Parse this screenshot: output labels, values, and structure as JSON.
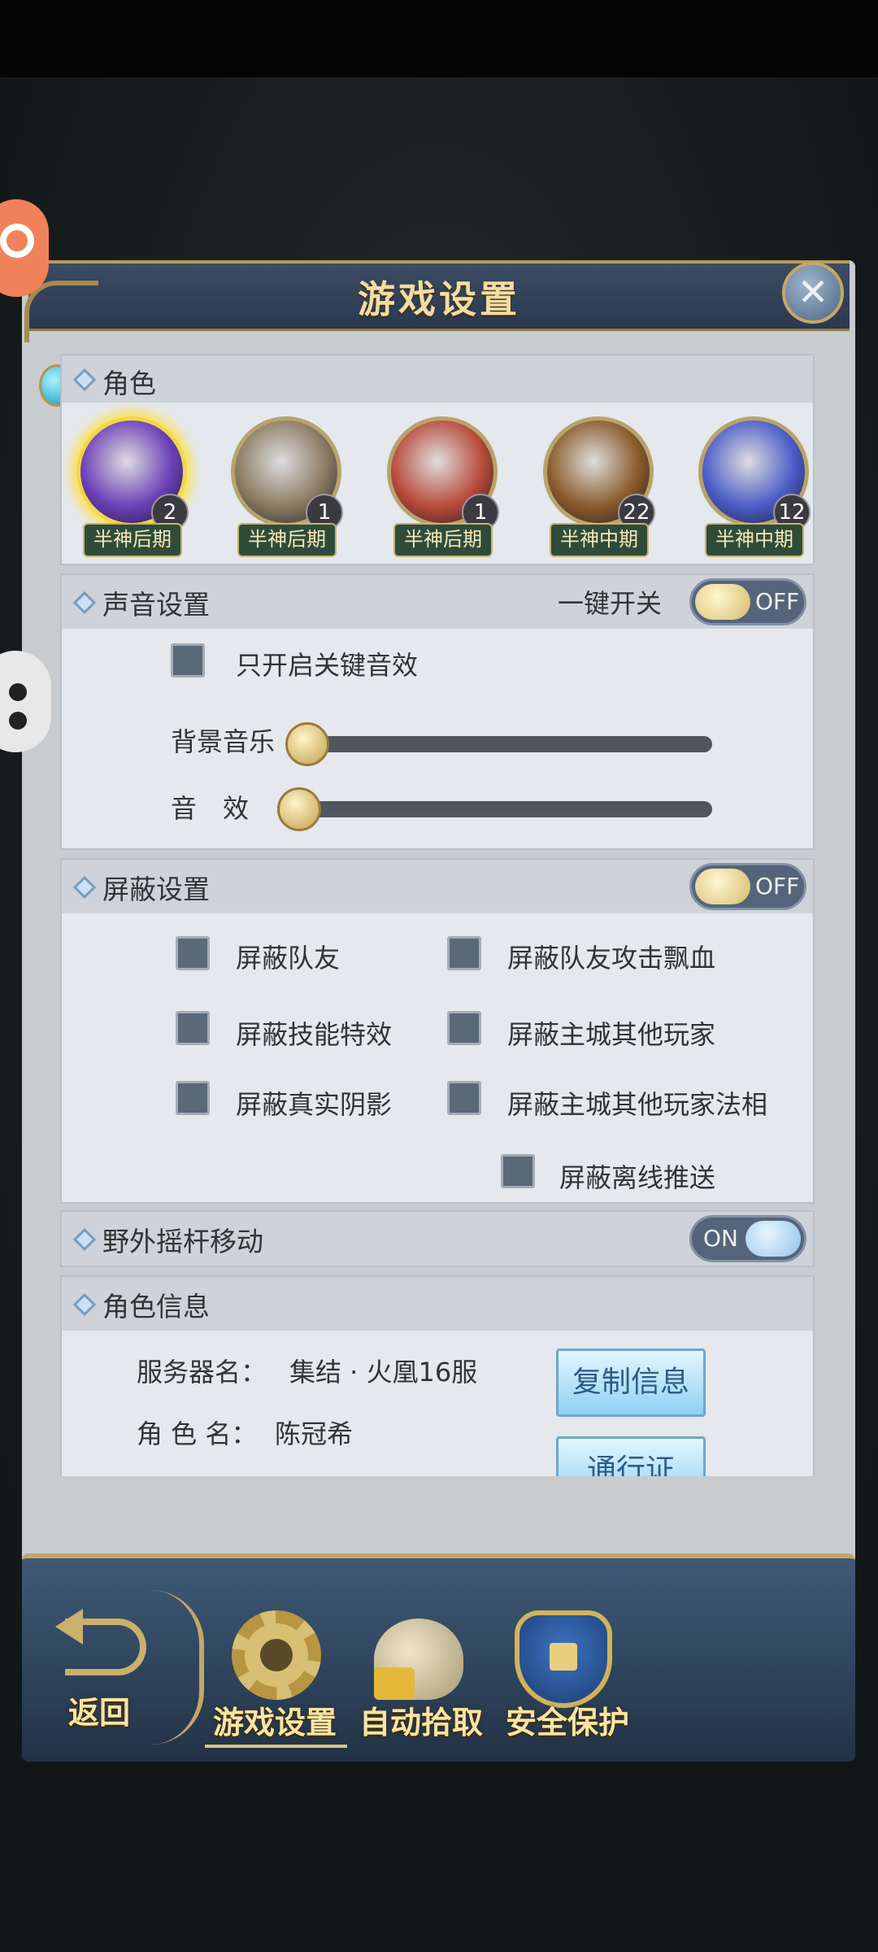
{
  "dialog": {
    "title": "游戏设置"
  },
  "roles": {
    "title": "角色",
    "items": [
      {
        "level": "2",
        "rank": "半神后期",
        "selected": true,
        "color": "#6b3fb8"
      },
      {
        "level": "1",
        "rank": "半神后期",
        "selected": false,
        "color": "#8b7a62"
      },
      {
        "level": "1",
        "rank": "半神后期",
        "selected": false,
        "color": "#b84a3a"
      },
      {
        "level": "22",
        "rank": "半神中期",
        "selected": false,
        "color": "#8a5a2a"
      },
      {
        "level": "12",
        "rank": "半神中期",
        "selected": false,
        "color": "#4a5cc8"
      }
    ]
  },
  "sound": {
    "title": "声音设置",
    "master_label": "一键开关",
    "master_state": "OFF",
    "key_only_label": "只开启关键音效",
    "bgm_label": "背景音乐",
    "bgm_level": 0,
    "sfx_label": "音　效",
    "sfx_level": 0
  },
  "block": {
    "title": "屏蔽设置",
    "state": "OFF",
    "options": {
      "teammates": "屏蔽队友",
      "team_attack_dmg": "屏蔽队友攻击飘血",
      "skill_fx": "屏蔽技能特效",
      "city_players": "屏蔽主城其他玩家",
      "shadows": "屏蔽真实阴影",
      "city_players_faxiang": "屏蔽主城其他玩家法相",
      "offline_push": "屏蔽离线推送"
    }
  },
  "joystick": {
    "title": "野外摇杆移动",
    "state": "ON"
  },
  "role_info": {
    "title": "角色信息",
    "server_label": "服务器名：",
    "server_value": "集结 · 火凰16服",
    "name_label": "角 色 名：",
    "name_value": "陈冠希",
    "copy_button": "复制信息",
    "pass_button": "通行证"
  },
  "bottom_nav": {
    "back": "返回",
    "game_settings": "游戏设置",
    "auto_pickup": "自动拾取",
    "security": "安全保护"
  }
}
